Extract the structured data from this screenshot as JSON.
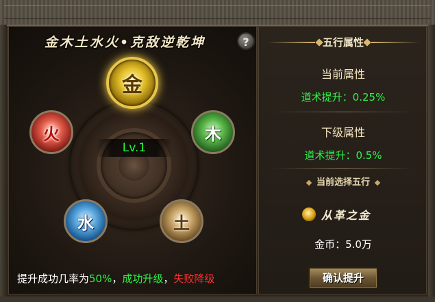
{
  "left_panel": {
    "title": "金木土水火•克敌逆乾坤",
    "help_label": "?",
    "level": "Lv.1",
    "elements": {
      "gold": "金",
      "wood": "木",
      "fire": "火",
      "water": "水",
      "earth": "土"
    },
    "rate": {
      "prefix": "提升成功几率为",
      "percent": "50%",
      "sep1": "，",
      "success": "成功升级",
      "sep2": "，",
      "fail": "失败降级"
    }
  },
  "right_panel": {
    "header": "五行属性",
    "current_label": "当前属性",
    "current_value": "道术提升：0.25%",
    "next_label": "下级属性",
    "next_value": "道术提升：0.5%",
    "selected_header": "当前选择五行",
    "selected_element": "从革之金",
    "coin": "金币：5.0万",
    "confirm_button": "确认提升"
  },
  "colors": {
    "success_green": "#2ff14a",
    "fail_red": "#ff2f2f",
    "level_green": "#1cff3a"
  }
}
